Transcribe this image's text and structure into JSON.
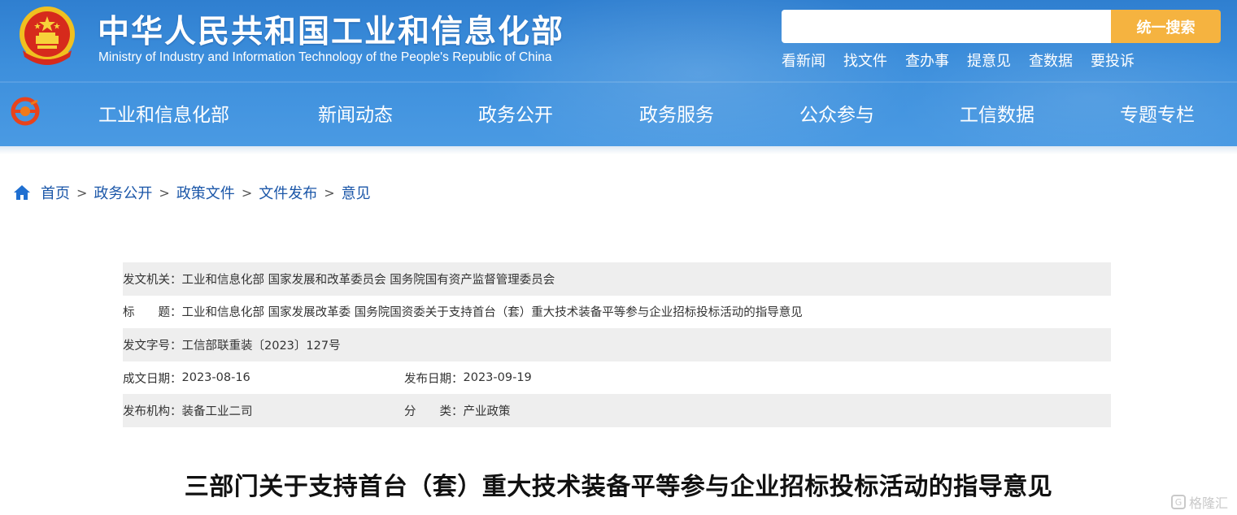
{
  "header": {
    "title": "中华人民共和国工业和信息化部",
    "subtitle": "Ministry of Industry and Information Technology of the People's Republic of China",
    "search_placeholder": "",
    "search_button": "统一搜索",
    "quick_links": [
      "看新闻",
      "找文件",
      "查办事",
      "提意见",
      "查数据",
      "要投诉"
    ]
  },
  "nav": {
    "items": [
      "工业和信息化部",
      "新闻动态",
      "政务公开",
      "政务服务",
      "公众参与",
      "工信数据",
      "专题专栏"
    ]
  },
  "breadcrumb": {
    "items": [
      "首页",
      "政务公开",
      "政策文件",
      "文件发布",
      "意见"
    ],
    "separator": ">"
  },
  "info": {
    "issuer_label": "发文机关：",
    "issuer_value": "工业和信息化部 国家发展和改革委员会 国务院国有资产监督管理委员会",
    "title_label": "标　　题：",
    "title_value": "工业和信息化部 国家发展改革委 国务院国资委关于支持首台（套）重大技术装备平等参与企业招标投标活动的指导意见",
    "docno_label": "发文字号：",
    "docno_value": "工信部联重装〔2023〕127号",
    "written_label": "成文日期：",
    "written_value": "2023-08-16",
    "published_label": "发布日期：",
    "published_value": "2023-09-19",
    "org_label": "发布机构：",
    "org_value": "装备工业二司",
    "category_label": "分　　类：",
    "category_value": "产业政策"
  },
  "article": {
    "title": "三部门关于支持首台（套）重大技术装备平等参与企业招标投标活动的指导意见"
  },
  "watermark": {
    "text": "格隆汇",
    "icon": "G"
  },
  "colors": {
    "header_blue": "#3d8fdc",
    "search_button": "#f5b340",
    "link_blue": "#1a56a8",
    "row_shade": "#eeeeee"
  }
}
